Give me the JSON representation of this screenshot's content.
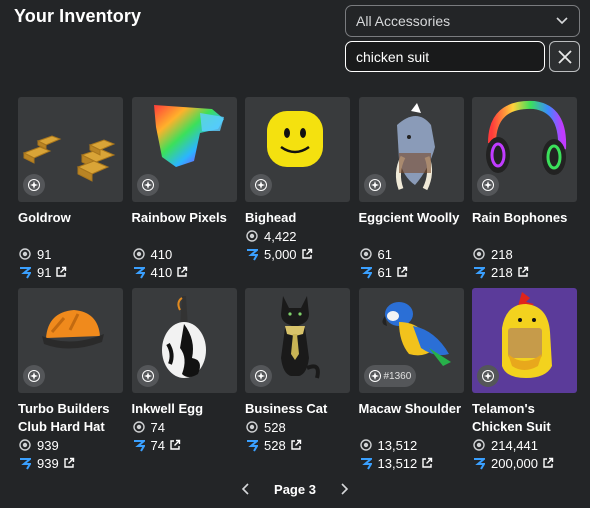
{
  "header": {
    "title": "Your Inventory"
  },
  "filter": {
    "selected": "All Accessories"
  },
  "search": {
    "value": "chicken suit"
  },
  "items": [
    {
      "name": "Goldrow",
      "value": "91",
      "price": "91"
    },
    {
      "name": "Rainbow Pixels",
      "value": "410",
      "price": "410"
    },
    {
      "name": "Bighead",
      "value": "4,422",
      "price": "5,000"
    },
    {
      "name": "Eggcient Woolly",
      "value": "61",
      "price": "61"
    },
    {
      "name": "Rain Bophones",
      "value": "218",
      "price": "218"
    },
    {
      "name": "Turbo Builders Club Hard Hat",
      "value": "939",
      "price": "939"
    },
    {
      "name": "Inkwell Egg",
      "value": "74",
      "price": "74"
    },
    {
      "name": "Business Cat",
      "value": "528",
      "price": "528"
    },
    {
      "name": "Macaw Shoulder",
      "value": "13,512",
      "price": "13,512",
      "serial": "#1360"
    },
    {
      "name": "Telamon's Chicken Suit",
      "value": "214,441",
      "price": "200,000"
    }
  ],
  "pagination": {
    "label": "Page 3"
  },
  "colors": {
    "background": "#232527",
    "card": "#393b3d",
    "price_icon": "#3aa0ff"
  }
}
